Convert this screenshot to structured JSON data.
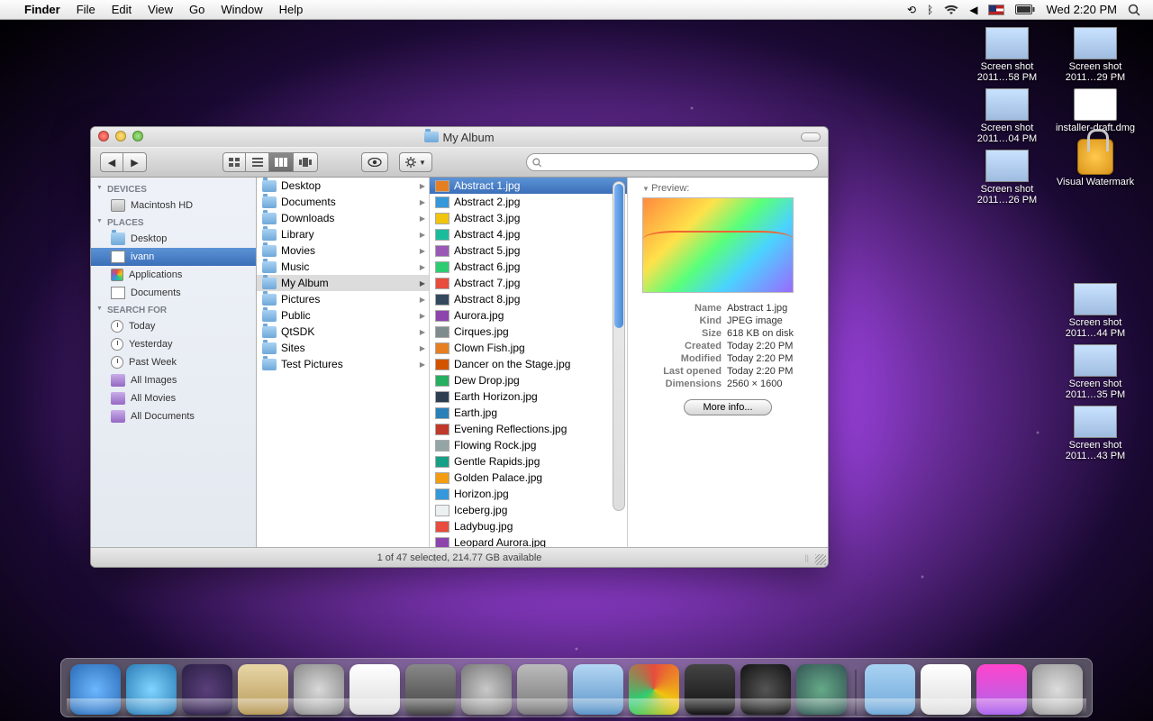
{
  "menubar": {
    "app": "Finder",
    "items": [
      "File",
      "Edit",
      "View",
      "Go",
      "Window",
      "Help"
    ],
    "clock": "Wed 2:20 PM"
  },
  "desktop_icons": {
    "col1": [
      {
        "label": "Screen shot 2011…58 PM"
      },
      {
        "label": "Screen shot 2011…04 PM"
      },
      {
        "label": "Screen shot 2011…26 PM"
      }
    ],
    "col2": [
      {
        "label": "Screen shot 2011…29 PM"
      },
      {
        "label": "installer-draft.dmg",
        "kind": "dmg"
      },
      {
        "label": "Visual Watermark",
        "kind": "lock"
      },
      {
        "label": "Screen shot 2011…44 PM"
      },
      {
        "label": "Screen shot 2011…35 PM"
      },
      {
        "label": "Screen shot 2011…43 PM"
      }
    ]
  },
  "window": {
    "title": "My Album",
    "sidebar": {
      "sections": {
        "DEVICES": [
          {
            "label": "Macintosh HD",
            "ico": "ico-hd"
          }
        ],
        "PLACES": [
          {
            "label": "Desktop",
            "ico": "ico-folder"
          },
          {
            "label": "ivann",
            "ico": "ico-home",
            "selected": true
          },
          {
            "label": "Applications",
            "ico": "ico-app"
          },
          {
            "label": "Documents",
            "ico": "ico-doc"
          }
        ],
        "SEARCH FOR": [
          {
            "label": "Today",
            "ico": "ico-clock"
          },
          {
            "label": "Yesterday",
            "ico": "ico-clock"
          },
          {
            "label": "Past Week",
            "ico": "ico-clock"
          },
          {
            "label": "All Images",
            "ico": "ico-purple"
          },
          {
            "label": "All Movies",
            "ico": "ico-purple"
          },
          {
            "label": "All Documents",
            "ico": "ico-purple"
          }
        ]
      }
    },
    "col1": [
      {
        "label": "Desktop"
      },
      {
        "label": "Documents"
      },
      {
        "label": "Downloads"
      },
      {
        "label": "Library"
      },
      {
        "label": "Movies"
      },
      {
        "label": "Music"
      },
      {
        "label": "My Album",
        "selected": true
      },
      {
        "label": "Pictures"
      },
      {
        "label": "Public"
      },
      {
        "label": "QtSDK"
      },
      {
        "label": "Sites"
      },
      {
        "label": "Test Pictures"
      }
    ],
    "col2": [
      {
        "label": "Abstract 1.jpg",
        "c": "#e67e22",
        "selected": true
      },
      {
        "label": "Abstract 2.jpg",
        "c": "#3498db"
      },
      {
        "label": "Abstract 3.jpg",
        "c": "#f1c40f"
      },
      {
        "label": "Abstract 4.jpg",
        "c": "#1abc9c"
      },
      {
        "label": "Abstract 5.jpg",
        "c": "#9b59b6"
      },
      {
        "label": "Abstract 6.jpg",
        "c": "#2ecc71"
      },
      {
        "label": "Abstract 7.jpg",
        "c": "#e74c3c"
      },
      {
        "label": "Abstract 8.jpg",
        "c": "#34495e"
      },
      {
        "label": "Aurora.jpg",
        "c": "#8e44ad"
      },
      {
        "label": "Cirques.jpg",
        "c": "#7f8c8d"
      },
      {
        "label": "Clown Fish.jpg",
        "c": "#e67e22"
      },
      {
        "label": "Dancer on the Stage.jpg",
        "c": "#d35400"
      },
      {
        "label": "Dew Drop.jpg",
        "c": "#27ae60"
      },
      {
        "label": "Earth Horizon.jpg",
        "c": "#2c3e50"
      },
      {
        "label": "Earth.jpg",
        "c": "#2980b9"
      },
      {
        "label": "Evening Reflections.jpg",
        "c": "#c0392b"
      },
      {
        "label": "Flowing Rock.jpg",
        "c": "#95a5a6"
      },
      {
        "label": "Gentle Rapids.jpg",
        "c": "#16a085"
      },
      {
        "label": "Golden Palace.jpg",
        "c": "#f39c12"
      },
      {
        "label": "Horizon.jpg",
        "c": "#3498db"
      },
      {
        "label": "Iceberg.jpg",
        "c": "#ecf0f1"
      },
      {
        "label": "Ladybug.jpg",
        "c": "#e74c3c"
      },
      {
        "label": "Leopard Aurora.jpg",
        "c": "#8e44ad"
      }
    ],
    "preview": {
      "header": "Preview:",
      "info": [
        {
          "label": "Name",
          "value": "Abstract 1.jpg"
        },
        {
          "label": "Kind",
          "value": "JPEG image"
        },
        {
          "label": "Size",
          "value": "618 KB on disk"
        },
        {
          "label": "Created",
          "value": "Today 2:20 PM"
        },
        {
          "label": "Modified",
          "value": "Today 2:20 PM"
        },
        {
          "label": "Last opened",
          "value": "Today 2:20 PM"
        },
        {
          "label": "Dimensions",
          "value": "2560 × 1600"
        }
      ],
      "more_info": "More info..."
    },
    "status": "1 of 47 selected, 214.77 GB available"
  },
  "dock": [
    {
      "name": "finder",
      "bg": "radial-gradient(#6cb7ff,#2a6bb5)"
    },
    {
      "name": "appstore",
      "bg": "radial-gradient(#7fd5ff,#2a7bb5)"
    },
    {
      "name": "eclipse",
      "bg": "radial-gradient(#5a3f7a,#2a1f45)"
    },
    {
      "name": "preview",
      "bg": "linear-gradient(#e8d6a6,#b89a5a)"
    },
    {
      "name": "itunes",
      "bg": "radial-gradient(#d9d9d9,#888)"
    },
    {
      "name": "ical",
      "bg": "linear-gradient(#fff,#ddd)"
    },
    {
      "name": "photobooth",
      "bg": "linear-gradient(#888,#444)"
    },
    {
      "name": "sysprefs",
      "bg": "radial-gradient(#c9c9c9,#777)"
    },
    {
      "name": "automator",
      "bg": "linear-gradient(#bbb,#777)"
    },
    {
      "name": "xcode",
      "bg": "linear-gradient(#b4d7f4,#5a93c8)"
    },
    {
      "name": "chrome",
      "bg": "conic-gradient(#e74c3c,#f1c40f,#2ecc71,#e74c3c)"
    },
    {
      "name": "terminal",
      "bg": "linear-gradient(#444,#111)"
    },
    {
      "name": "facetime",
      "bg": "radial-gradient(#555,#111)"
    },
    {
      "name": "timemachine",
      "bg": "radial-gradient(#6a8,#355)"
    },
    {
      "sep": true
    },
    {
      "name": "folder",
      "bg": "linear-gradient(#a9d2f3,#6fa8d8)"
    },
    {
      "name": "textedit",
      "bg": "linear-gradient(#fff,#ddd)"
    },
    {
      "name": "stack",
      "bg": "linear-gradient(#f4c,#a6e)"
    },
    {
      "name": "trash",
      "bg": "radial-gradient(#ddd,#999)"
    }
  ]
}
